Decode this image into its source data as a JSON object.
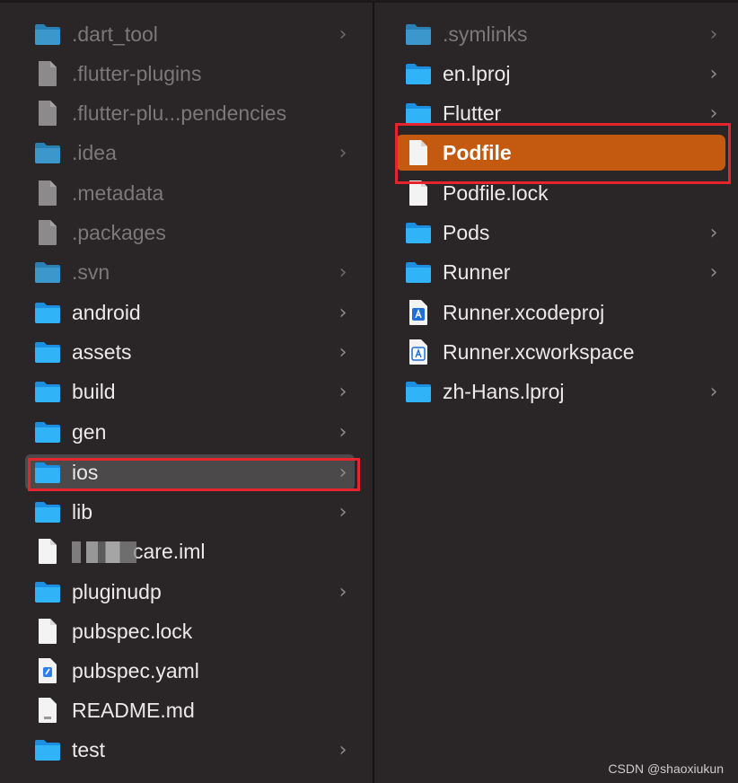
{
  "colors": {
    "background": "#2a2628",
    "folder": "#2aa3ef",
    "selection_orange": "#c45a10",
    "selection_gray": "#4c494a",
    "annotation_red": "#e5242d"
  },
  "left_column": {
    "items": [
      {
        "label": ".dart_tool",
        "icon": "folder-icon",
        "has_chevron": true,
        "dim": true
      },
      {
        "label": ".flutter-plugins",
        "icon": "file-icon",
        "has_chevron": false,
        "dim": true
      },
      {
        "label": ".flutter-plu...pendencies",
        "icon": "file-icon",
        "has_chevron": false,
        "dim": true
      },
      {
        "label": ".idea",
        "icon": "folder-icon",
        "has_chevron": true,
        "dim": true
      },
      {
        "label": ".metadata",
        "icon": "file-icon",
        "has_chevron": false,
        "dim": true
      },
      {
        "label": ".packages",
        "icon": "file-icon",
        "has_chevron": false,
        "dim": true
      },
      {
        "label": ".svn",
        "icon": "folder-icon",
        "has_chevron": true,
        "dim": true
      },
      {
        "label": "android",
        "icon": "folder-icon",
        "has_chevron": true,
        "dim": false
      },
      {
        "label": "assets",
        "icon": "folder-icon",
        "has_chevron": true,
        "dim": false
      },
      {
        "label": "build",
        "icon": "folder-icon",
        "has_chevron": true,
        "dim": false
      },
      {
        "label": "gen",
        "icon": "folder-icon",
        "has_chevron": true,
        "dim": false
      },
      {
        "label": "ios",
        "icon": "folder-icon",
        "has_chevron": true,
        "dim": false,
        "selected": true
      },
      {
        "label": "lib",
        "icon": "folder-icon",
        "has_chevron": true,
        "dim": false
      },
      {
        "label": "care.iml",
        "icon": "file-icon",
        "has_chevron": false,
        "dim": false,
        "redacted_prefix": true
      },
      {
        "label": "pluginudp",
        "icon": "folder-icon",
        "has_chevron": true,
        "dim": false
      },
      {
        "label": "pubspec.lock",
        "icon": "file-icon",
        "has_chevron": false,
        "dim": false
      },
      {
        "label": "pubspec.yaml",
        "icon": "yaml-file-icon",
        "has_chevron": false,
        "dim": false
      },
      {
        "label": "README.md",
        "icon": "markdown-file-icon",
        "has_chevron": false,
        "dim": false
      },
      {
        "label": "test",
        "icon": "folder-icon",
        "has_chevron": true,
        "dim": false
      }
    ]
  },
  "right_column": {
    "items": [
      {
        "label": ".symlinks",
        "icon": "folder-icon",
        "has_chevron": true,
        "dim": true
      },
      {
        "label": "en.lproj",
        "icon": "folder-icon",
        "has_chevron": true,
        "dim": false
      },
      {
        "label": "Flutter",
        "icon": "folder-icon",
        "has_chevron": true,
        "dim": false
      },
      {
        "label": "Podfile",
        "icon": "file-icon",
        "has_chevron": false,
        "dim": false,
        "selected": true
      },
      {
        "label": "Podfile.lock",
        "icon": "file-icon",
        "has_chevron": false,
        "dim": false
      },
      {
        "label": "Pods",
        "icon": "folder-icon",
        "has_chevron": true,
        "dim": false
      },
      {
        "label": "Runner",
        "icon": "folder-icon",
        "has_chevron": true,
        "dim": false
      },
      {
        "label": "Runner.xcodeproj",
        "icon": "xcodeproj-icon",
        "has_chevron": false,
        "dim": false
      },
      {
        "label": "Runner.xcworkspace",
        "icon": "xcworkspace-icon",
        "has_chevron": false,
        "dim": false
      },
      {
        "label": "zh-Hans.lproj",
        "icon": "folder-icon",
        "has_chevron": true,
        "dim": false
      }
    ]
  },
  "watermark": "CSDN @shaoxiukun"
}
